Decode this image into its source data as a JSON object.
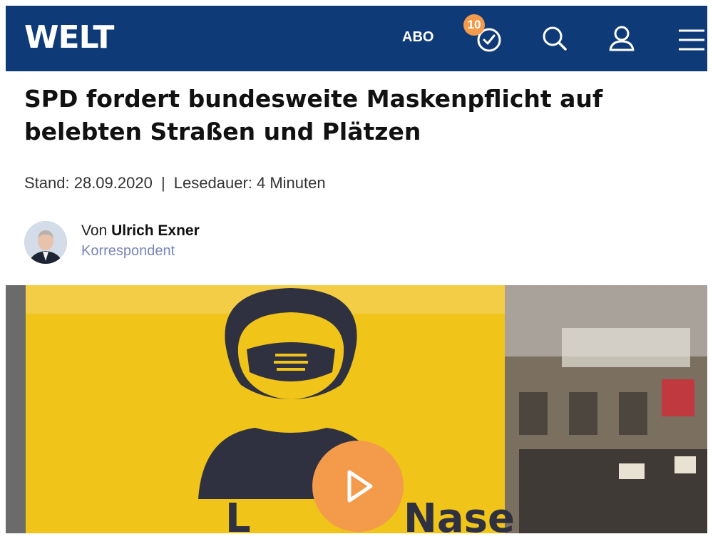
{
  "header": {
    "logo": "WELT",
    "abo_label": "ABO",
    "reading_list_count": "10",
    "icons": [
      "clock-icon",
      "search-icon",
      "user-icon",
      "menu-icon"
    ]
  },
  "article": {
    "headline": "SPD fordert bundesweite Maskenpflicht auf belebten Straßen und Plätzen",
    "stand": "Stand: 28.09.2020",
    "separator": "|",
    "reading_time": "Lesedauer: 4 Minuten",
    "author": {
      "prefix": "Von",
      "name": "Ulrich Exner",
      "role": "Korrespondent"
    },
    "hero": {
      "sign_text_visible": "Nase",
      "play_icon": "play-icon"
    }
  },
  "colors": {
    "header_bg": "#0f3a78",
    "accent": "#f39a4b",
    "sign_yellow": "#f0c419"
  }
}
